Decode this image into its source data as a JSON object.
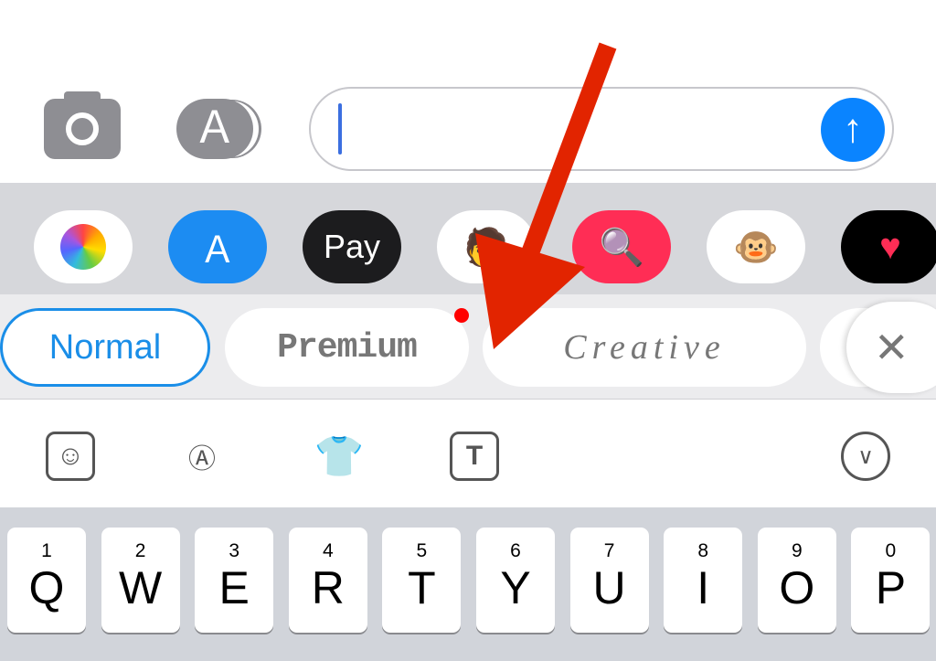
{
  "compose": {
    "placeholder": "",
    "send_icon": "arrow-up-icon",
    "camera_icon": "camera-icon",
    "apps_icon": "app-store-icon"
  },
  "app_strip": [
    {
      "name": "Photos",
      "icon": "photos-icon",
      "bg": "#ffffff"
    },
    {
      "name": "App Store",
      "icon": "app-store-icon",
      "bg": "#1c8cf2"
    },
    {
      "name": "Apple Pay",
      "label": "Pay",
      "icon": "apple-icon",
      "bg": "#1c1c1e"
    },
    {
      "name": "Memoji",
      "icon": "memoji-icon",
      "bg": "#ffffff"
    },
    {
      "name": "Search",
      "icon": "globe-search-icon",
      "bg": "#ff2d55"
    },
    {
      "name": "Animoji",
      "icon": "monkey-icon",
      "bg": "#ffffff"
    },
    {
      "name": "Digital Touch",
      "icon": "heart-icon",
      "bg": "#000000"
    }
  ],
  "styles": {
    "items": [
      "Normal",
      "Premium",
      "Creative"
    ],
    "selected": "Normal",
    "accent": "#1a8ee8",
    "badge_color": "#ff0000",
    "close_icon": "close-icon"
  },
  "tools": [
    {
      "icon": "sticker-face-icon"
    },
    {
      "icon": "translate-icon"
    },
    {
      "icon": "tshirt-icon"
    },
    {
      "icon": "text-t-icon"
    },
    {
      "icon": "chevron-down-circle-icon"
    }
  ],
  "keyboard": {
    "row1": [
      {
        "num": "1",
        "letter": "Q"
      },
      {
        "num": "2",
        "letter": "W"
      },
      {
        "num": "3",
        "letter": "E"
      },
      {
        "num": "4",
        "letter": "R"
      },
      {
        "num": "5",
        "letter": "T"
      },
      {
        "num": "6",
        "letter": "Y"
      },
      {
        "num": "7",
        "letter": "U"
      },
      {
        "num": "8",
        "letter": "I"
      },
      {
        "num": "9",
        "letter": "O"
      },
      {
        "num": "0",
        "letter": "P"
      }
    ]
  },
  "annotation": {
    "color": "#e22400"
  }
}
